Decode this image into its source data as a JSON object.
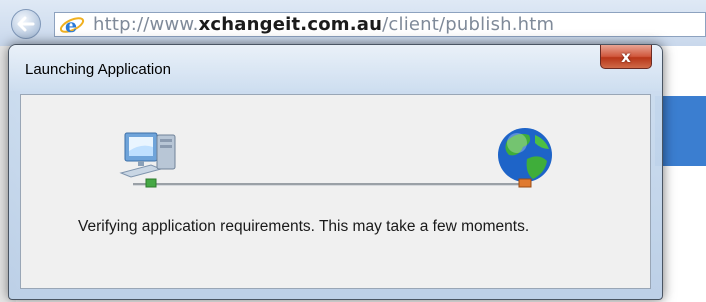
{
  "browser": {
    "url": {
      "prefix": "http://www.",
      "domain": "xchangeit.com.au",
      "path": "/client/publish.htm"
    }
  },
  "dialog": {
    "title": "Launching Application",
    "close_glyph": "x",
    "message": "Verifying application requirements. This may take a few moments."
  },
  "icons": [
    "back-arrow-icon",
    "internet-explorer-icon",
    "computer-icon",
    "globe-icon"
  ],
  "colors": {
    "close_button": "#c8442a",
    "title_bar": "#c8daee",
    "content_bg": "#f0f0f0"
  }
}
